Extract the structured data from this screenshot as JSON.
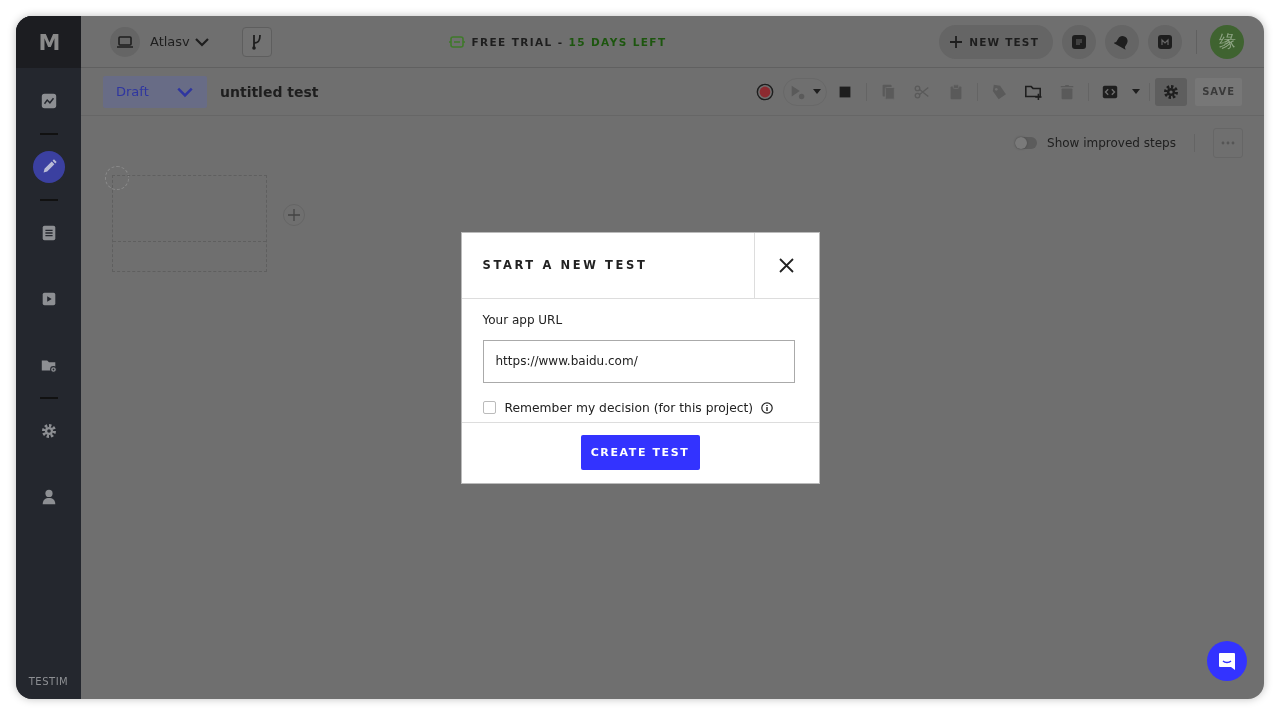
{
  "sidebar": {
    "logo": "M",
    "items": [
      {
        "kind": "link",
        "selected": false
      },
      {
        "kind": "divider"
      },
      {
        "kind": "link",
        "selected": true
      },
      {
        "kind": "divider"
      },
      {
        "kind": "link",
        "selected": false
      },
      {
        "kind": "link",
        "selected": false
      },
      {
        "kind": "link",
        "selected": false
      },
      {
        "kind": "divider"
      },
      {
        "kind": "link",
        "selected": false
      },
      {
        "kind": "link",
        "selected": false
      }
    ],
    "footer": "TESTIM"
  },
  "topbar": {
    "project": "Atlasv",
    "trial_label": "FREE TRIAL -",
    "trial_days": "15 DAYS LEFT",
    "new_test": "NEW TEST",
    "avatar": "缘"
  },
  "toolbar": {
    "status": "Draft",
    "test_name": "untitled test",
    "tools": [
      {
        "disabled": false
      },
      {
        "disabled": true
      },
      {
        "disabled": false
      },
      {
        "disabled": true
      },
      {
        "disabled": true
      },
      {
        "disabled": true
      },
      {
        "disabled": true
      },
      {
        "disabled": false
      },
      {
        "disabled": true
      },
      {
        "disabled": false
      }
    ],
    "settings": {
      "selected": true
    },
    "save": {
      "label": "SAVE",
      "disabled": true
    }
  },
  "canvas": {
    "improved_steps": {
      "label": "Show improved steps",
      "on": false
    }
  },
  "dialog": {
    "title": "START A NEW TEST",
    "url_label": "Your app URL",
    "url_value": "https://www.baidu.com/",
    "remember": {
      "label": "Remember my decision (for this project)",
      "checked": false
    },
    "submit": "CREATE TEST"
  }
}
